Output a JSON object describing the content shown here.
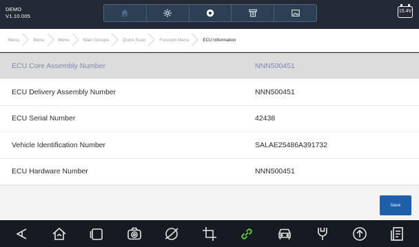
{
  "header": {
    "mode": "DEMO",
    "version": "V1.10.005",
    "battery_voltage": "15.4V"
  },
  "toolbar": {
    "items": [
      {
        "icon": "home-icon",
        "enabled": false
      },
      {
        "icon": "settings-icon",
        "enabled": true
      },
      {
        "icon": "record-icon",
        "enabled": true
      },
      {
        "icon": "printer-icon",
        "enabled": true
      },
      {
        "icon": "image-icon",
        "enabled": true
      }
    ]
  },
  "breadcrumb": [
    "Menu",
    "Menu",
    "Menu",
    "Main Groups",
    "Quick Scan",
    "Function Menu",
    "ECU Information"
  ],
  "ecu_info": [
    {
      "label": "ECU Core Assembly Number",
      "value": "NNN500451"
    },
    {
      "label": "ECU Delivery Assembly Number",
      "value": "NNN500451"
    },
    {
      "label": "ECU Serial Number",
      "value": "42438"
    },
    {
      "label": "Vehicle Identification Number",
      "value": "SALAE25486A391732"
    },
    {
      "label": "ECU Hardware Number",
      "value": "NNN500451"
    }
  ],
  "actions": {
    "save_label": "Save"
  },
  "nav_icons": [
    "back-icon",
    "home-icon",
    "recent-apps-icon",
    "camera-icon",
    "browser-icon",
    "crop-icon",
    "vci-link-icon",
    "car-icon",
    "repair-icon",
    "upload-icon",
    "report-icon"
  ],
  "colors": {
    "accent": "#1d5fa9",
    "selected_row": "#dcdcdc",
    "active_nav": "#5fdc3a",
    "header": "#232a35"
  }
}
